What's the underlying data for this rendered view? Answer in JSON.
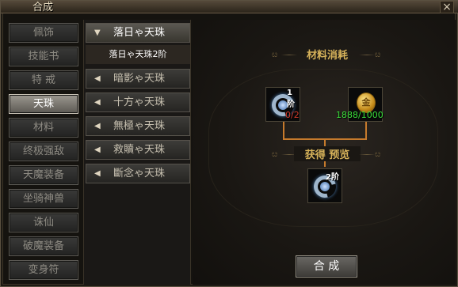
{
  "window": {
    "title": "合成",
    "close_glyph": "×"
  },
  "categories": [
    {
      "label": "佩饰",
      "active": false
    },
    {
      "label": "技能书",
      "active": false
    },
    {
      "label": "特 戒",
      "active": false
    },
    {
      "label": "天珠",
      "active": true
    },
    {
      "label": "材料",
      "active": false
    },
    {
      "label": "终极强敌",
      "active": false
    },
    {
      "label": "天魔装备",
      "active": false
    },
    {
      "label": "坐骑神兽",
      "active": false
    },
    {
      "label": "诛仙",
      "active": false
    },
    {
      "label": "破魔装备",
      "active": false
    },
    {
      "label": "变身符",
      "active": false
    }
  ],
  "sub_items": [
    {
      "label": "落日ゃ天珠",
      "expanded": true,
      "children": [
        "落日ゃ天珠2阶"
      ]
    },
    {
      "label": "暗影ゃ天珠",
      "expanded": false
    },
    {
      "label": "十方ゃ天珠",
      "expanded": false
    },
    {
      "label": "無極ゃ天珠",
      "expanded": false
    },
    {
      "label": "救贖ゃ天珠",
      "expanded": false
    },
    {
      "label": "斷念ゃ天珠",
      "expanded": false
    }
  ],
  "materials": {
    "title": "材料消耗",
    "items": [
      {
        "icon": "sky-pearl-icon",
        "tier": "1阶",
        "count": "0/2",
        "count_color": "#d03a2a"
      },
      {
        "icon": "gold-coin-icon",
        "coin_glyph": "金",
        "count": "1888/1000",
        "count_color": "#3adf3a"
      }
    ]
  },
  "preview": {
    "title": "获得  预览",
    "item": {
      "icon": "sky-pearl-icon",
      "tier": "2阶"
    }
  },
  "actions": {
    "merge_label": "合 成"
  },
  "ornament": "ೞ"
}
